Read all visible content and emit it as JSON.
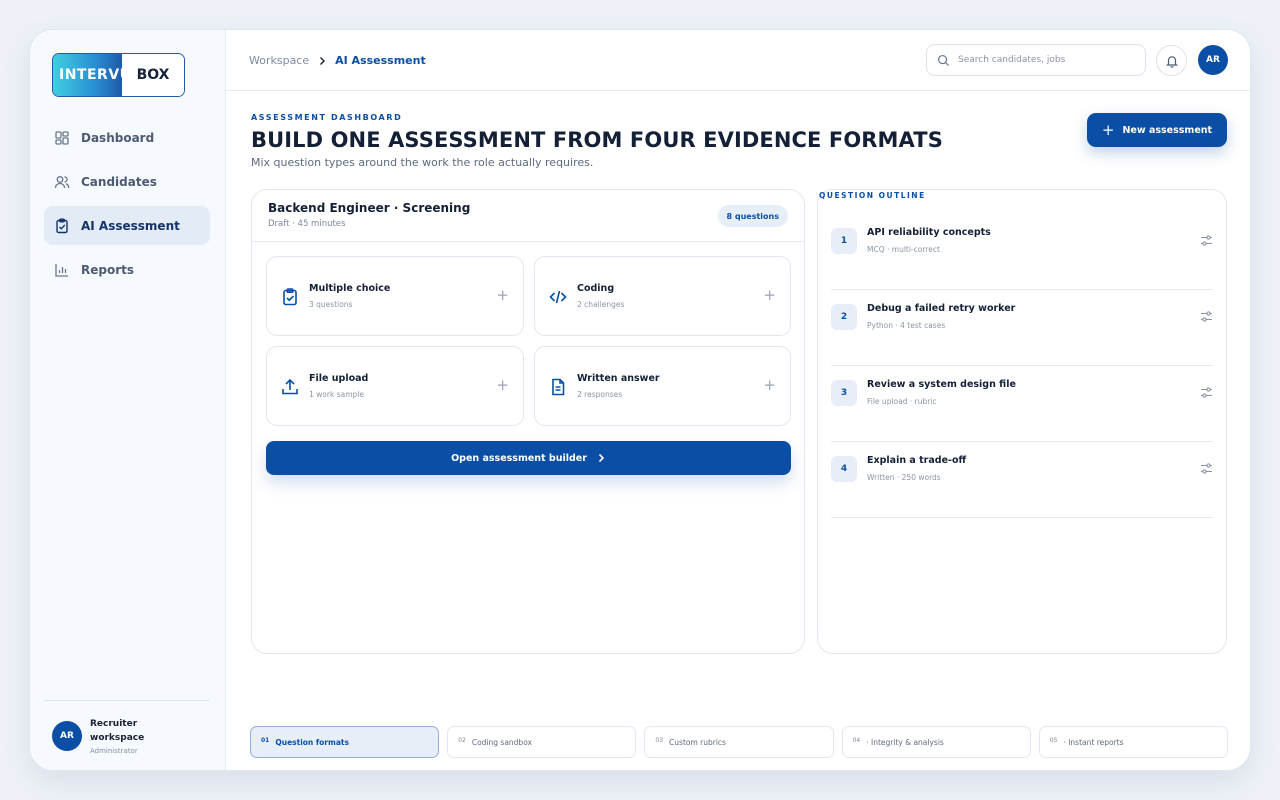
{
  "brand": {
    "logo_left": "INTERVUE",
    "logo_right": "BOX"
  },
  "sidebar": {
    "items": [
      {
        "label": "Dashboard",
        "icon": "grid-icon"
      },
      {
        "label": "Candidates",
        "icon": "users-icon"
      },
      {
        "label": "AI Assessment",
        "icon": "clipboard-check-icon",
        "active": true
      },
      {
        "label": "Reports",
        "icon": "bar-chart-icon"
      }
    ],
    "user": {
      "initials": "AR",
      "name": "Recruiter workspace",
      "role": "Administrator"
    }
  },
  "topbar": {
    "breadcrumb": [
      "Workspace",
      "AI Assessment"
    ],
    "search_placeholder": "Search candidates, jobs",
    "avatar_initials": "AR"
  },
  "header": {
    "eyebrow": "ASSESSMENT DASHBOARD",
    "title": "BUILD ONE ASSESSMENT FROM FOUR EVIDENCE FORMATS",
    "subtitle": "Mix question types around the work the role actually requires.",
    "new_button": "New assessment"
  },
  "assessment": {
    "title": "Backend Engineer · Screening",
    "meta": "Draft · 45 minutes",
    "badge": "8 questions",
    "formats": [
      {
        "name": "Multiple choice",
        "count": "3 questions",
        "icon": "clipboard-check-icon"
      },
      {
        "name": "Coding",
        "count": "2 challenges",
        "icon": "code-icon"
      },
      {
        "name": "File upload",
        "count": "1 work sample",
        "icon": "upload-icon"
      },
      {
        "name": "Written answer",
        "count": "2 responses",
        "icon": "document-icon"
      }
    ],
    "builder_button": "Open assessment builder"
  },
  "outline": {
    "label": "QUESTION OUTLINE",
    "items": [
      {
        "num": "1",
        "title": "API reliability concepts",
        "sub": "MCQ · multi-correct"
      },
      {
        "num": "2",
        "title": "Debug a failed retry worker",
        "sub": "Python · 4 test cases"
      },
      {
        "num": "3",
        "title": "Review a system design file",
        "sub": "File upload · rubric"
      },
      {
        "num": "4",
        "title": "Explain a trade-off",
        "sub": "Written · 250 words"
      }
    ]
  },
  "feature_tabs": [
    {
      "num": "01",
      "label": "Question formats",
      "active": true
    },
    {
      "num": "02",
      "label": "Coding sandbox"
    },
    {
      "num": "03",
      "label": "Custom rubrics"
    },
    {
      "num": "04",
      "label": "· Integrity & analysis"
    },
    {
      "num": "05",
      "label": "· Instant reports"
    }
  ],
  "colors": {
    "accent": "#0a4fa5",
    "background": "#eef2f8"
  }
}
